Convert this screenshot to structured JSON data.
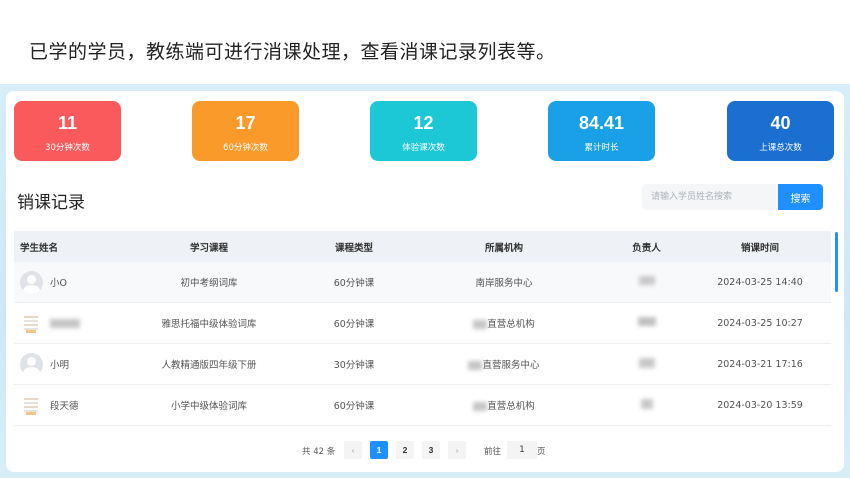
{
  "caption": "已学的学员，教练端可进行消课处理，查看消课记录列表等。",
  "stats": [
    {
      "value": "11",
      "label": "30分钟次数",
      "color": "#fb5a5c"
    },
    {
      "value": "17",
      "label": "60分钟次数",
      "color": "#f99a2b"
    },
    {
      "value": "12",
      "label": "体验课次数",
      "color": "#1cc8d6"
    },
    {
      "value": "84.41",
      "label": "累计时长",
      "color": "#1aa0e6"
    },
    {
      "value": "40",
      "label": "上课总次数",
      "color": "#1a6fd0"
    }
  ],
  "section_title": "销课记录",
  "search": {
    "placeholder": "请输入学员姓名搜索",
    "button": "搜索"
  },
  "table": {
    "headers": [
      "学生姓名",
      "学习课程",
      "课程类型",
      "所属机构",
      "负责人",
      "销课时间"
    ],
    "rows": [
      {
        "name": "小O",
        "course": "初中考纲词库",
        "type": "60分钟课",
        "org": "南岸服务中心",
        "owner": "",
        "time": "2024-03-25 14:40"
      },
      {
        "name": "",
        "course": "雅思托福中级体验词库",
        "type": "60分钟课",
        "org": "直营总机构",
        "owner": "",
        "time": "2024-03-25 10:27"
      },
      {
        "name": "小明",
        "course": "人教精通版四年级下册",
        "type": "30分钟课",
        "org": "直营服务中心",
        "owner": "",
        "time": "2024-03-21 17:16"
      },
      {
        "name": "段天德",
        "course": "小学中级体验词库",
        "type": "60分钟课",
        "org": "直营总机构",
        "owner": "",
        "time": "2024-03-20 13:59"
      }
    ]
  },
  "pager": {
    "total": "共 42 条",
    "prev": "‹",
    "pages": [
      "1",
      "2",
      "3"
    ],
    "next": "›",
    "goto": "前往",
    "jump_value": "1",
    "unit": "页"
  },
  "icons": {
    "prev": "chevron-left-icon",
    "next": "chevron-right-icon",
    "avatar": "user-avatar-icon"
  },
  "accent": "#1e90ff"
}
